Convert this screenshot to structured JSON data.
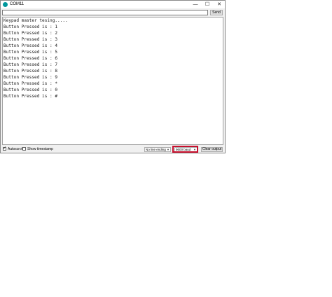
{
  "window": {
    "title": "COM11"
  },
  "controls": {
    "minimize": "—",
    "maximize": "☐",
    "close": "✕"
  },
  "input": {
    "value": "",
    "send_label": "Send"
  },
  "output": {
    "lines": [
      "Keypad master tesing.....",
      "Button Pressed is : 1",
      "Button Pressed is : 2",
      "Button Pressed is : 3",
      "Button Pressed is : 4",
      "Button Pressed is : 5",
      "Button Pressed is : 6",
      "Button Pressed is : 7",
      "Button Pressed is : 8",
      "Button Pressed is : 9",
      "Button Pressed is : *",
      "Button Pressed is : 0",
      "Button Pressed is : #"
    ]
  },
  "status": {
    "autoscroll_label": "Autoscroll",
    "autoscroll_checked": true,
    "timestamp_label": "Show timestamp",
    "timestamp_checked": false,
    "line_ending": "No line ending",
    "baud": "9600 baud",
    "clear_label": "Clear output"
  },
  "colors": {
    "accent_highlight": "#c8102e",
    "app_icon": "#00979c"
  }
}
